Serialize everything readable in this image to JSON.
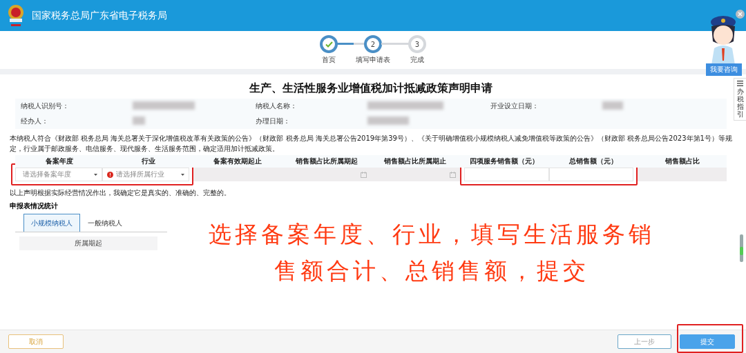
{
  "header": {
    "title": "国家税务总局广东省电子税务局"
  },
  "steps": [
    {
      "label": "首页",
      "done": true,
      "current": false
    },
    {
      "number": "2",
      "label": "填写申请表",
      "done": false,
      "current": true
    },
    {
      "number": "3",
      "label": "完成",
      "done": false,
      "current": false
    }
  ],
  "assistant": {
    "button": "我要咨询",
    "side_tab": "办税指引"
  },
  "form": {
    "title": "生产、生活性服务业增值税加计抵减政策声明申请",
    "info": [
      {
        "label": "纳税人识别号：",
        "blurred": true
      },
      {
        "label": "纳税人名称：",
        "blurred": true
      },
      {
        "label": "开业设立日期：",
        "blurred": true
      },
      {
        "label": "经办人：",
        "blurred": true
      },
      {
        "label": "办理日期：",
        "blurred": true
      }
    ],
    "statement": "本纳税人符合《财政部 税务总局 海关总署关于深化增值税改革有关政策的公告》（财政部 税务总局 海关总署公告2019年第39号）、《关于明确增值税小规模纳税人减免增值税等政策的公告》（财政部 税务总局公告2023年第1号）等规定，行业属于邮政服务、电信服务、现代服务、生活服务范围，确定适用加计抵减政策。",
    "columns": [
      "备案年度",
      "行业",
      "备案有效期起止",
      "销售额占比所属期起",
      "销售额占比所属期止",
      "四项服务销售额（元）",
      "总销售额（元）",
      "销售额占比"
    ],
    "cells": [
      {
        "kind": "select",
        "placeholder": "请选择备案年度",
        "error": false
      },
      {
        "kind": "select",
        "placeholder": "请选择所属行业",
        "error": true
      },
      {
        "kind": "readonly"
      },
      {
        "kind": "date"
      },
      {
        "kind": "date"
      },
      {
        "kind": "input"
      },
      {
        "kind": "input"
      },
      {
        "kind": "readonly"
      }
    ],
    "declaration": "以上声明根据实际经营情况作出，我确定它是真实的、准确的、完整的。",
    "stats_title": "申报表情况统计",
    "tabs": [
      {
        "label": "小规模纳税人",
        "selected": true
      },
      {
        "label": "一般纳税人",
        "selected": false
      }
    ],
    "stats_columns": [
      "所属期起"
    ]
  },
  "annotation": {
    "lines": [
      "选择备案年度、行业，填写生活服务销",
      "售额合计、总销售额，提交"
    ]
  },
  "footer": {
    "cancel": "取消",
    "back": "上一步",
    "submit": "提交"
  }
}
